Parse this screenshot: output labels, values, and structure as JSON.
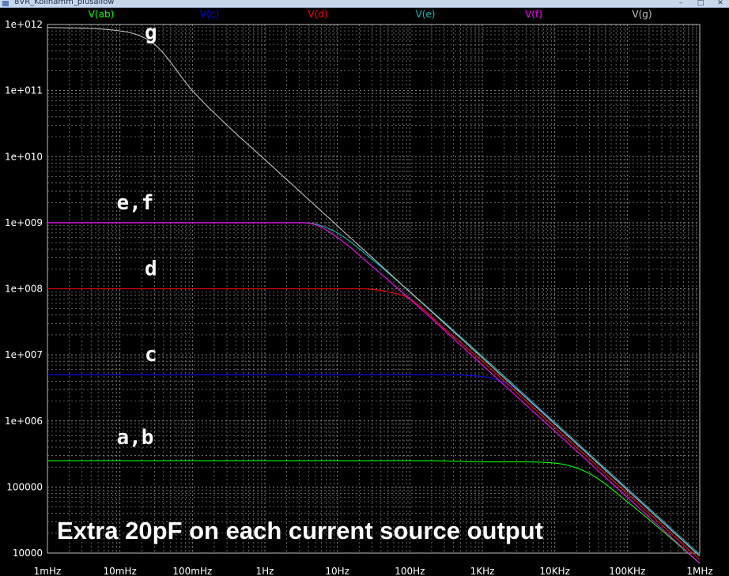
{
  "window": {
    "title": "8VR_Kollhamm_plusallow",
    "buttons": {
      "minimize": "–",
      "restore": "□",
      "close": "✕"
    }
  },
  "chart_data": {
    "type": "line",
    "x_scale": "log",
    "y_scale": "log",
    "xlim": [
      0.001,
      1000000
    ],
    "ylim": [
      10000,
      1000000000000
    ],
    "grid": true,
    "background": "#000000",
    "gridColor": "#8a8a8a",
    "x_ticks": [
      {
        "value": 0.001,
        "label": "1mHz"
      },
      {
        "value": 0.01,
        "label": "10mHz"
      },
      {
        "value": 0.1,
        "label": "100mHz"
      },
      {
        "value": 1,
        "label": "1Hz"
      },
      {
        "value": 10,
        "label": "10Hz"
      },
      {
        "value": 100,
        "label": "100Hz"
      },
      {
        "value": 1000,
        "label": "1KHz"
      },
      {
        "value": 10000,
        "label": "10KHz"
      },
      {
        "value": 100000,
        "label": "100KHz"
      },
      {
        "value": 1000000,
        "label": "1MHz"
      }
    ],
    "y_ticks": [
      {
        "value": 1000000000000,
        "label": "1e+012"
      },
      {
        "value": 100000000000,
        "label": "1e+011"
      },
      {
        "value": 10000000000,
        "label": "1e+010"
      },
      {
        "value": 1000000000,
        "label": "1e+009"
      },
      {
        "value": 100000000,
        "label": "1e+008"
      },
      {
        "value": 10000000,
        "label": "1e+007"
      },
      {
        "value": 1000000,
        "label": "1e+006"
      },
      {
        "value": 100000,
        "label": "100000"
      },
      {
        "value": 10000,
        "label": "10000"
      }
    ],
    "series": [
      {
        "name": "V(ab)",
        "color": "#00ff00",
        "points": [
          [
            0.001,
            250000
          ],
          [
            200,
            250000
          ],
          [
            1000,
            240000
          ],
          [
            3000,
            240000
          ],
          [
            10000,
            230000
          ],
          [
            30000,
            160000
          ],
          [
            100000,
            60000
          ],
          [
            300000,
            22000
          ],
          [
            1000000,
            7000
          ]
        ]
      },
      {
        "name": "V(c)",
        "color": "#0000ff",
        "points": [
          [
            0.001,
            5000000
          ],
          [
            200,
            5000000
          ],
          [
            1000,
            4700000
          ],
          [
            2000,
            3800000
          ],
          [
            3000,
            3000000
          ],
          [
            10000,
            900000
          ],
          [
            100000,
            90000
          ],
          [
            1000000,
            9000
          ]
        ]
      },
      {
        "name": "V(d)",
        "color": "#ff0000",
        "points": [
          [
            0.001,
            100000000
          ],
          [
            20,
            100000000
          ],
          [
            50,
            90000000
          ],
          [
            100,
            70000000
          ],
          [
            300,
            25000000
          ],
          [
            1000,
            8000000
          ],
          [
            10000,
            800000
          ],
          [
            100000,
            80000
          ],
          [
            1000000,
            8000
          ]
        ]
      },
      {
        "name": "V(e)",
        "color": "#00bfbf",
        "points": [
          [
            0.001,
            1000000000
          ],
          [
            3,
            1000000000
          ],
          [
            5,
            950000000
          ],
          [
            10,
            700000000
          ],
          [
            30,
            280000000
          ],
          [
            100,
            90000000
          ],
          [
            1000,
            9500000
          ],
          [
            10000,
            950000
          ],
          [
            100000,
            95000
          ],
          [
            1000000,
            9500
          ]
        ]
      },
      {
        "name": "V(f)",
        "color": "#ff00ff",
        "points": [
          [
            0.001,
            1000000000
          ],
          [
            3,
            1000000000
          ],
          [
            5,
            930000000
          ],
          [
            10,
            600000000
          ],
          [
            30,
            220000000
          ],
          [
            100,
            70000000
          ],
          [
            1000,
            7000000
          ],
          [
            10000,
            700000
          ],
          [
            100000,
            70000
          ],
          [
            1000000,
            7000
          ]
        ]
      },
      {
        "name": "V(g)",
        "color": "#bfbfbf",
        "points": [
          [
            0.001,
            900000000000
          ],
          [
            0.01,
            800000000000
          ],
          [
            0.03,
            500000000000
          ],
          [
            0.1,
            100000000000
          ],
          [
            0.3,
            30000000000
          ],
          [
            1,
            9000000000
          ],
          [
            10,
            900000000
          ],
          [
            100,
            90000000
          ],
          [
            1000,
            9000000
          ],
          [
            10000,
            900000
          ],
          [
            100000,
            90000
          ],
          [
            1000000,
            9000
          ]
        ]
      }
    ],
    "annotations": [
      {
        "text": "g",
        "x": 0.022,
        "y": 600000000000
      },
      {
        "text": "e,f",
        "x": 0.009,
        "y": 1600000000
      },
      {
        "text": "d",
        "x": 0.022,
        "y": 160000000
      },
      {
        "text": "c",
        "x": 0.022,
        "y": 8000000
      },
      {
        "text": "a,b",
        "x": 0.009,
        "y": 450000
      }
    ],
    "caption": "Extra 20pF on each current source output"
  }
}
